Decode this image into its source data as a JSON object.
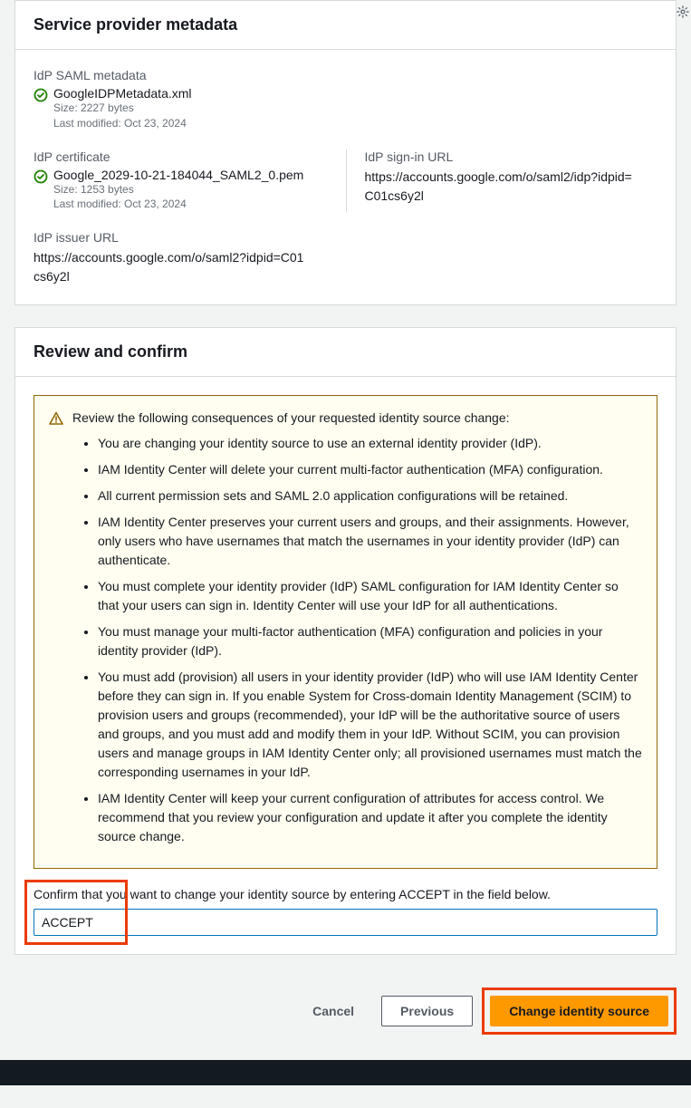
{
  "panel1": {
    "title": "Service provider metadata",
    "saml_metadata": {
      "label": "IdP SAML metadata",
      "filename": "GoogleIDPMetadata.xml",
      "size": "Size: 2227 bytes",
      "modified": "Last modified: Oct 23, 2024"
    },
    "certificate": {
      "label": "IdP certificate",
      "filename": "Google_2029-10-21-184044_SAML2_0.pem",
      "size": "Size: 1253 bytes",
      "modified": "Last modified: Oct 23, 2024"
    },
    "signin_url": {
      "label": "IdP sign-in URL",
      "value": "https://accounts.google.com/o/saml2/idp?idpid=C01cs6y2l"
    },
    "issuer_url": {
      "label": "IdP issuer URL",
      "value": "https://accounts.google.com/o/saml2?idpid=C01cs6y2l"
    }
  },
  "panel2": {
    "title": "Review and confirm",
    "alert_intro": "Review the following consequences of your requested identity source change:",
    "consequences": [
      "You are changing your identity source to use an external identity provider (IdP).",
      "IAM Identity Center will delete your current multi-factor authentication (MFA) configuration.",
      "All current permission sets and SAML 2.0 application configurations will be retained.",
      "IAM Identity Center preserves your current users and groups, and their assignments. However, only users who have usernames that match the usernames in your identity provider (IdP) can authenticate.",
      "You must complete your identity provider (IdP) SAML configuration for IAM Identity Center so that your users can sign in. Identity Center will use your IdP for all authentications.",
      "You must manage your multi-factor authentication (MFA) configuration and policies in your identity provider (IdP).",
      "You must add (provision) all users in your identity provider (IdP) who will use IAM Identity Center before they can sign in. If you enable System for Cross-domain Identity Management (SCIM) to provision users and groups (recommended), your IdP will be the authoritative source of users and groups, and you must add and modify them in your IdP. Without SCIM, you can provision users and manage groups in IAM Identity Center only; all provisioned usernames must match the corresponding usernames in your IdP.",
      "IAM Identity Center will keep your current configuration of attributes for access control. We recommend that you review your configuration and update it after you complete the identity source change."
    ],
    "confirm_label": "Confirm that you want to change your identity source by entering ACCEPT in the field below.",
    "confirm_value": "ACCEPT"
  },
  "actions": {
    "cancel": "Cancel",
    "previous": "Previous",
    "change": "Change identity source"
  }
}
